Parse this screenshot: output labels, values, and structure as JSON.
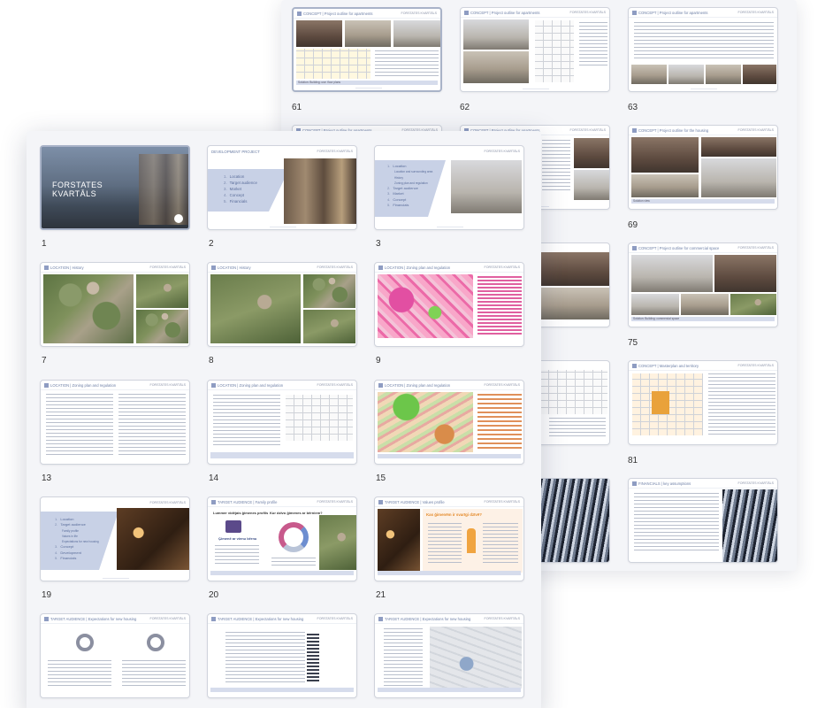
{
  "brand": "FORSTATES KVARTĀLS",
  "back_sheet": {
    "slides": [
      {
        "number": "61",
        "header": "CONCEPT | Project outline for apartments",
        "caption": "Solution: Building: use: floor plans"
      },
      {
        "number": "62",
        "header": "CONCEPT | Project outline for apartments",
        "caption": ""
      },
      {
        "number": "63",
        "header": "CONCEPT | Project outline for apartments",
        "caption": ""
      },
      {
        "number": "",
        "header": "CONCEPT | Project outline for apartments",
        "caption": ""
      },
      {
        "number": "",
        "header": "CONCEPT | Project outline for apartments",
        "caption": ""
      },
      {
        "number": "69",
        "header": "CONCEPT | Project outline for the housing",
        "caption": "Solution view"
      },
      {
        "number": "",
        "header": "",
        "caption": ""
      },
      {
        "number": "75",
        "header": "CONCEPT | Project outline for commercial space",
        "caption": "Solution: Building: commercial space"
      },
      {
        "number": "",
        "header": "",
        "caption": ""
      },
      {
        "number": "81",
        "header": "CONCEPT | Masterplan and territory",
        "caption": ""
      },
      {
        "number": "",
        "header": "",
        "caption": ""
      },
      {
        "number": "",
        "header": "FINANCIALS | key assumptions",
        "caption": ""
      }
    ]
  },
  "front_sheet": {
    "slides": [
      {
        "number": "1",
        "title": "FORSTATES\nKVARTĀLS"
      },
      {
        "number": "2",
        "header": "DEVELOPMENT PROJECT",
        "menu": [
          "Location",
          "Target audience",
          "Market",
          "Concept",
          "Financials"
        ]
      },
      {
        "number": "3",
        "menu": [
          "Location",
          "Location and surrounding area",
          "History",
          "Zoning plan and regulation",
          "Target audience",
          "Market",
          "Concept",
          "Financials"
        ]
      },
      {
        "number": "7",
        "header": "LOCATION | History"
      },
      {
        "number": "8",
        "header": "LOCATION | History"
      },
      {
        "number": "9",
        "header": "LOCATION | Zoning plan and regulation"
      },
      {
        "number": "13",
        "header": "LOCATION | Zoning plan and regulation"
      },
      {
        "number": "14",
        "header": "LOCATION | Zoning plan and regulation"
      },
      {
        "number": "15",
        "header": "LOCATION | Zoning plan and regulation"
      },
      {
        "number": "19",
        "menu": [
          "Location",
          "Target audience",
          "Family profile",
          "Values in life",
          "Expectations for new housing",
          "Concept",
          "Development",
          "Financials"
        ]
      },
      {
        "number": "20",
        "header": "TARGET AUDIENCE | Family profile",
        "headline_left": "Lummer vidējais ģimenes profils",
        "headline_right": "Kur dzīvo ģimenes ar bērniem?",
        "callout": "Ģimenē ar vienu bērnu"
      },
      {
        "number": "21",
        "header": "TARGET AUDIENCE | Values profile",
        "headline": "Kas ģimenēm ir svarīgi dzīvē?"
      },
      {
        "number": "",
        "header": "TARGET AUDIENCE | Expectations for new housing"
      },
      {
        "number": "",
        "header": "TARGET AUDIENCE | Expectations for new housing"
      },
      {
        "number": "",
        "header": "TARGET AUDIENCE | Expectations for new housing"
      }
    ]
  }
}
